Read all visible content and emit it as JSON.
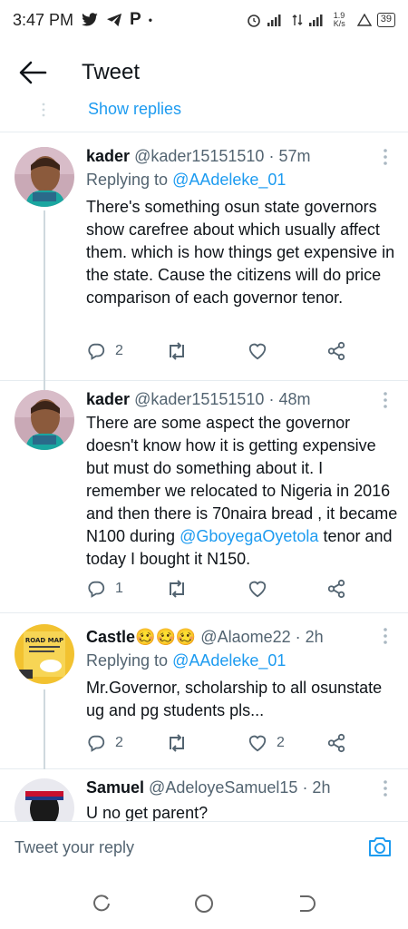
{
  "status_bar": {
    "time": "3:47 PM",
    "left_icons": [
      "twitter-icon",
      "telegram-icon",
      "p-icon",
      "dot"
    ],
    "network_speed": "1.9 K/s",
    "battery": "39"
  },
  "appbar": {
    "title": "Tweet"
  },
  "thread": {
    "show_replies": "Show replies"
  },
  "tweets": [
    {
      "name": "kader",
      "handle": "@kader15151510",
      "time": "· 57m",
      "replying_prefix": "Replying to",
      "replying_to": "@AAdeleke_01",
      "text": "There's something osun state governors show carefree about which usually affect them. which is how things get expensive in the state. Cause the citizens will do price comparison of each governor tenor.",
      "replies": "2",
      "retweets": "",
      "likes": ""
    },
    {
      "name": "kader",
      "handle": "@kader15151510",
      "time": "· 48m",
      "text_before": "There are some aspect the governor doesn't know how it is getting expensive but must do something about it. I remember we relocated to Nigeria in 2016 and then there is 70naira bread , it became N100 during ",
      "mention": "@GboyegaOyetola",
      "text_after": " tenor and today I bought it N150.",
      "replies": "1",
      "retweets": "",
      "likes": ""
    },
    {
      "name": "Castle",
      "emojis": "🥴🥴🥴",
      "handle": "@Alaome22",
      "time": "· 2h",
      "replying_prefix": "Replying to",
      "replying_to": "@AAdeleke_01",
      "text": "Mr.Governor, scholarship to all osunstate ug and pg students pls...",
      "replies": "2",
      "retweets": "",
      "likes": "2",
      "avatar_text": "ROAD MAP"
    },
    {
      "name": "Samuel",
      "handle": "@AdeloyeSamuel15",
      "time": "· 2h",
      "text": "U no get parent?"
    }
  ],
  "composer": {
    "placeholder": "Tweet your reply"
  },
  "colors": {
    "accent": "#1d9bf0",
    "text_secondary": "#536471",
    "border": "#e6ecf0"
  }
}
